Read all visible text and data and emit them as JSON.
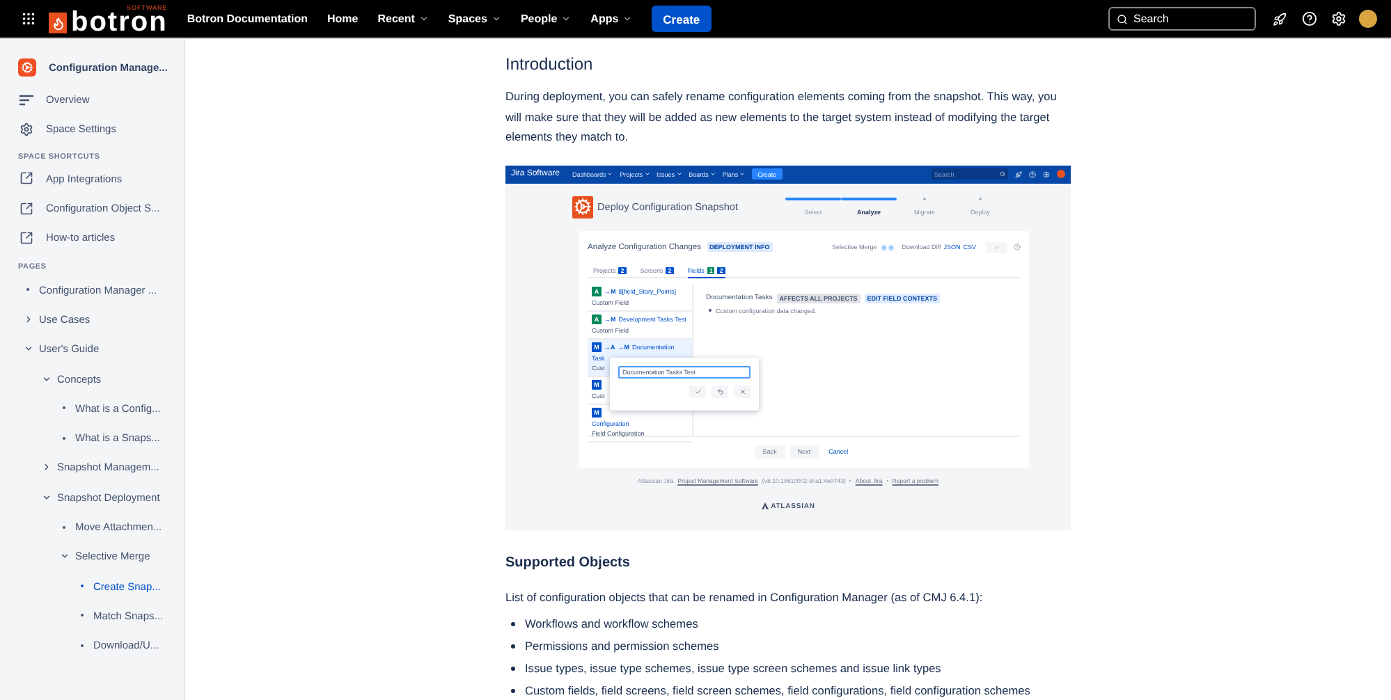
{
  "top_nav": {
    "logo": {
      "text": "botron",
      "tagline": "SOFTWARE"
    },
    "items": [
      {
        "label": "Botron Documentation",
        "kind": "link"
      },
      {
        "label": "Home",
        "kind": "link"
      },
      {
        "label": "Recent",
        "kind": "menu"
      },
      {
        "label": "Spaces",
        "kind": "menu"
      },
      {
        "label": "People",
        "kind": "menu"
      },
      {
        "label": "Apps",
        "kind": "menu"
      }
    ],
    "create": "Create",
    "search": {
      "placeholder": "Search"
    }
  },
  "sidebar": {
    "space_title": "Configuration Manage...",
    "nav": [
      {
        "label": "Overview",
        "kind": "overview"
      },
      {
        "label": "Space Settings",
        "kind": "settings"
      }
    ],
    "shortcuts_heading": "SPACE SHORTCUTS",
    "shortcuts": [
      "App Integrations",
      "Configuration Object S...",
      "How-to articles"
    ],
    "pages_heading": "PAGES",
    "pages": [
      {
        "label": "Configuration Manager ...",
        "kind": "page",
        "selected": false
      },
      {
        "label": "Use Cases",
        "kind": "folder",
        "expanded": false,
        "selected": false
      },
      {
        "label": "User's Guide",
        "kind": "folder",
        "expanded": true,
        "selected": false,
        "children": [
          {
            "label": "Concepts",
            "kind": "folder",
            "expanded": true,
            "selected": false,
            "children": [
              {
                "label": "What is a Config...",
                "kind": "page",
                "selected": false
              },
              {
                "label": "What is a Snaps...",
                "kind": "page",
                "selected": false
              }
            ]
          },
          {
            "label": "Snapshot Managem...",
            "kind": "folder",
            "expanded": false,
            "selected": false
          },
          {
            "label": "Snapshot Deployment",
            "kind": "folder",
            "expanded": true,
            "selected": false,
            "children": [
              {
                "label": "Move Attachmen...",
                "kind": "page",
                "selected": false
              },
              {
                "label": "Selective Merge",
                "kind": "folder",
                "expanded": true,
                "selected": false,
                "children": [
                  {
                    "label": "Create Snap...",
                    "kind": "page",
                    "selected": true
                  },
                  {
                    "label": "Match Snaps...",
                    "kind": "page",
                    "selected": false
                  },
                  {
                    "label": "Download/U...",
                    "kind": "page",
                    "selected": false
                  }
                ]
              }
            ]
          }
        ]
      }
    ]
  },
  "article": {
    "intro_heading": "Introduction",
    "intro_text": "During deployment, you can safely rename configuration elements coming from the snapshot. This way, you will make sure that they will be added as new elements to the target system instead of modifying the target elements they match to.",
    "figure": {
      "header": {
        "product": "Jira Software",
        "menus": [
          "Dashboards",
          "Projects",
          "Issues",
          "Boards",
          "Plans"
        ],
        "create": "Create",
        "search_placeholder": "Search"
      },
      "title": "Deploy Configuration Snapshot",
      "steps": [
        {
          "label": "Select",
          "complete": true,
          "selected": false
        },
        {
          "label": "Analyze",
          "complete": true,
          "selected": true
        },
        {
          "label": "Migrate",
          "complete": false,
          "selected": false
        },
        {
          "label": "Deploy",
          "complete": false,
          "selected": false
        }
      ],
      "card_title": "Analyze Configuration Changes",
      "card_badge": "DEPLOYMENT INFO",
      "merge_label": "Selective Merge",
      "download_label": "Download Diff",
      "download_links": [
        "JSON",
        "CSV"
      ],
      "tabs": [
        {
          "label": "Projects",
          "selected": false,
          "counts": [
            {
              "text": "2",
              "color": "#0052cc"
            }
          ]
        },
        {
          "label": "Screens",
          "selected": false,
          "counts": [
            {
              "text": "2",
              "color": "#0052cc"
            }
          ]
        },
        {
          "label": "Fields",
          "selected": true,
          "counts": [
            {
              "text": "1",
              "color": "#00875a"
            },
            {
              "text": "2",
              "color": "#0052cc"
            }
          ]
        }
      ],
      "fields": [
        {
          "badge": "A",
          "color": "#00875a",
          "flags": [
            "→M"
          ],
          "title": "$[field_Story_Points]",
          "lines": [
            {
              "text": "Custom Field",
              "kind": "type"
            }
          ],
          "selected": false
        },
        {
          "badge": "A",
          "color": "#00875a",
          "flags": [
            "→M"
          ],
          "title": "Development Tasks Test",
          "lines": [
            {
              "text": "Custom Field",
              "kind": "type"
            }
          ],
          "selected": false
        },
        {
          "badge": "M",
          "color": "#0052cc",
          "flags": [
            "→A",
            "→M"
          ],
          "title": "Documentation",
          "lines": [
            {
              "text": "Task",
              "kind": "link"
            },
            {
              "text": "Cust",
              "kind": "type"
            }
          ],
          "selected": true
        },
        {
          "badge": "M",
          "color": "#0052cc",
          "lines": [
            {
              "text": "Cust",
              "kind": "type"
            }
          ],
          "selected": false
        },
        {
          "badge": "M",
          "color": "#0052cc",
          "lines": [
            {
              "text": "Configuration",
              "kind": "link"
            },
            {
              "text": "Field Configuration",
              "kind": "type"
            }
          ],
          "selected": false
        }
      ],
      "detail": {
        "title": "Documentation Tasks",
        "badges": [
          "AFFECTS ALL PROJECTS",
          "EDIT FIELD CONTEXTS"
        ],
        "note": "Custom configuration data changed."
      },
      "popup": {
        "value": "Documentation Tasks Test"
      },
      "buttons": [
        {
          "label": "Back",
          "kind": "button"
        },
        {
          "label": "Next",
          "kind": "button"
        },
        {
          "label": "Cancel",
          "kind": "link"
        }
      ],
      "footer": [
        {
          "text": "Atlassian Jira",
          "kind": "text"
        },
        {
          "text": "Project Management Software",
          "kind": "link"
        },
        {
          "text": "(v8.10.1#810002-sha1:4e9743)",
          "kind": "text"
        },
        {
          "text": "About Jira",
          "kind": "link"
        },
        {
          "text": "Report a problem",
          "kind": "link"
        }
      ],
      "brand": "ATLASSIAN"
    },
    "section_heading": "Supported Objects",
    "section_text": "List of configuration objects that can be renamed in Configuration Manager (as of CMJ 6.4.1):",
    "list": [
      "Workflows and workflow schemes",
      "Permissions and permission schemes",
      "Issue types, issue type schemes, issue type screen schemes and issue link types",
      "Custom fields, field screens, field screen schemes, field configurations, field configuration schemes"
    ]
  }
}
